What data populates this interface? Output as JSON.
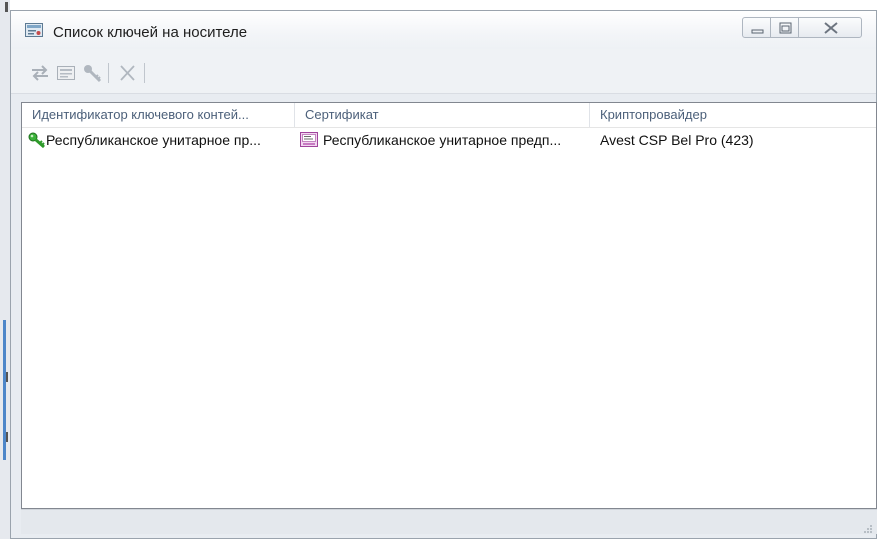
{
  "window": {
    "title": "Список ключей на носителе",
    "icons": {
      "title": "certificate-store-icon"
    }
  },
  "toolbar": {
    "buttons": [
      {
        "icon": "refresh-arrows-icon",
        "enabled": false
      },
      {
        "icon": "certificate-view-icon",
        "enabled": false
      },
      {
        "icon": "key-icon",
        "enabled": false
      },
      {
        "icon": "delete-x-icon",
        "enabled": false
      }
    ]
  },
  "list": {
    "columns": [
      "Идентификатор ключевого контей...",
      "Сертификат",
      "Криптопровайдер"
    ],
    "rows": [
      {
        "container": "Республиканское унитарное пр...",
        "certificate": "Республиканское унитарное предп...",
        "provider": "Avest CSP Bel Pro (423)",
        "container_icon": "green-key-icon",
        "certificate_icon": "certificate-icon"
      }
    ]
  },
  "colors": {
    "accent": "#4d86c9",
    "key_green": "#2e9a2a",
    "header_text": "#4c607a"
  }
}
